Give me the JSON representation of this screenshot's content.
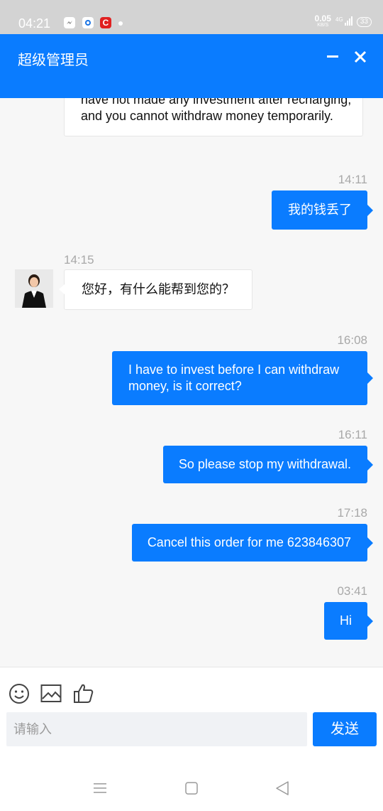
{
  "status_bar": {
    "time": "04:21",
    "speed": "0.05",
    "speed_unit": "KB/S",
    "network": "4G",
    "battery": "33",
    "notification_icons": [
      "messenger-icon",
      "app-icon",
      "c-app-icon",
      "dot-icon"
    ]
  },
  "header": {
    "title": "超级管理员",
    "minimize_icon": "minus-icon",
    "close_icon": "close-icon"
  },
  "messages": [
    {
      "side": "left",
      "text": "have not made any investment after recharging, and you cannot withdraw money temporarily."
    },
    {
      "side": "right",
      "time": "14:11",
      "text": "我的钱丢了"
    },
    {
      "side": "left",
      "time": "14:15",
      "text": "您好，有什么能帮到您的？",
      "avatar": "agent-avatar"
    },
    {
      "side": "right",
      "time": "16:08",
      "text": "I have to invest before I can withdraw money, is it correct?"
    },
    {
      "side": "right",
      "time": "16:11",
      "text": "So please stop my withdrawal."
    },
    {
      "side": "right",
      "time": "17:18",
      "text": "Cancel this order for me 623846307"
    },
    {
      "side": "right",
      "time": "03:41",
      "text": "Hi"
    }
  ],
  "toolbar": {
    "icons": [
      "emoji-icon",
      "image-icon",
      "thumbs-up-icon"
    ]
  },
  "composer": {
    "placeholder": "请输入",
    "send_label": "发送"
  },
  "nav_bar": {
    "icons": [
      "menu-icon",
      "home-square-icon",
      "back-triangle-icon"
    ]
  },
  "colors": {
    "accent": "#0a7cff",
    "background": "#f7f7f7"
  }
}
